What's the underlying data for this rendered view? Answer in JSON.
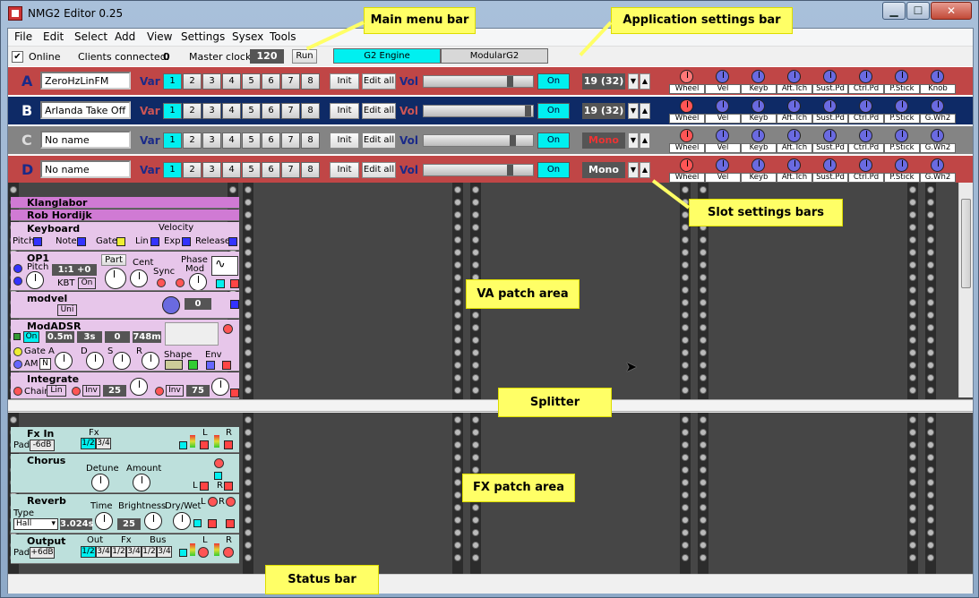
{
  "window": {
    "title": "NMG2 Editor 0.25",
    "min": "▁",
    "max": "☐",
    "close": "✕"
  },
  "menu": [
    "File",
    "Edit",
    "Select",
    "Add",
    "View",
    "Settings",
    "Sysex",
    "Tools"
  ],
  "settings": {
    "online_label": "Online",
    "online_checked": "✔",
    "clients_label": "Clients connected:",
    "clients_value": "0",
    "clock_label": "Master clock",
    "clock_value": "120",
    "run_label": "Run",
    "tab_engine": "G2 Engine",
    "tab_modular": "ModularG2"
  },
  "slot_common": {
    "var_label": "Var",
    "vol_label": "Vol",
    "init_label": "Init",
    "editall_label": "Edit all",
    "on_label": "On",
    "var_numbers": [
      "1",
      "2",
      "3",
      "4",
      "5",
      "6",
      "7",
      "8"
    ],
    "up": "▲",
    "down": "▼"
  },
  "slots": [
    {
      "letter": "A",
      "name": "ZeroHzLinFM",
      "voices": "19 (32)",
      "ctrls": [
        "Wheel",
        "Vel",
        "Keyb",
        "Aft.Tch",
        "Sust.Pd",
        "Ctrl.Pd",
        "P.Stick",
        "Knob"
      ]
    },
    {
      "letter": "B",
      "name": "Arlanda Take Off",
      "voices": "19 (32)",
      "ctrls": [
        "Wheel",
        "Vel",
        "Keyb",
        "Aft.Tch",
        "Sust.Pd",
        "Ctrl.Pd",
        "P.Stick",
        "G.Wh2"
      ]
    },
    {
      "letter": "C",
      "name": "No name",
      "voices": "Mono",
      "ctrls": [
        "Wheel",
        "Vel",
        "Keyb",
        "Aft.Tch",
        "Sust.Pd",
        "Ctrl.Pd",
        "P.Stick",
        "G.Wh2"
      ]
    },
    {
      "letter": "D",
      "name": "No name",
      "voices": "Mono",
      "ctrls": [
        "Wheel",
        "Vel",
        "Keyb",
        "Aft.Tch",
        "Sust.Pd",
        "Ctrl.Pd",
        "P.Stick",
        "G.Wh2"
      ]
    }
  ],
  "va_modules": {
    "klang": "Klanglabor",
    "rob": "Rob Hordijk",
    "keyboard": {
      "title": "Keyboard",
      "velocity": "Velocity",
      "pitch": "Pitch",
      "note": "Note",
      "gate": "Gate",
      "lin": "Lin",
      "exp": "Exp",
      "release": "Release"
    },
    "op1": {
      "title": "OP1",
      "pitch": "Pitch",
      "ratio": "1:1",
      "offset": "+0",
      "part": "Part",
      "cent": "Cent",
      "sync": "Sync",
      "phase": "Phase",
      "mod": "Mod",
      "kbt": "KBT",
      "on": "On"
    },
    "modvel": {
      "title": "modvel",
      "uni": "Uni",
      "value": "0"
    },
    "modadsr": {
      "title": "ModADSR",
      "on": "On",
      "a_val": "0.5m",
      "d_val": "3s",
      "s_val": "0",
      "r_val": "748m",
      "gate": "Gate",
      "am": "AM",
      "n": "N",
      "a": "A",
      "d": "D",
      "s": "S",
      "r": "R",
      "shape": "Shape",
      "env": "Env"
    },
    "integrate": {
      "title": "Integrate",
      "chain": "Chain",
      "lin": "Lin",
      "inv": "Inv",
      "v1": "25",
      "v2": "75"
    }
  },
  "fx_modules": {
    "fxin": {
      "title": "Fx In",
      "fx": "Fx",
      "pad": "Pad",
      "pad_val": "-6dB",
      "b1": "1/2",
      "b2": "3/4",
      "l": "L",
      "r": "R"
    },
    "chorus": {
      "title": "Chorus",
      "detune": "Detune",
      "amount": "Amount",
      "l": "L",
      "r": "R"
    },
    "reverb": {
      "title": "Reverb",
      "type": "Type",
      "hall": "Hall",
      "time": "Time",
      "time_val": "3.024s",
      "brightness": "Brightness",
      "bright_val": "25",
      "drywet": "Dry/Wet",
      "l": "L",
      "r": "R"
    },
    "output": {
      "title": "Output",
      "out": "Out",
      "fx": "Fx",
      "bus": "Bus",
      "pad": "Pad",
      "pad_val": "+6dB",
      "o1": "1/2",
      "o2": "3/4",
      "f1": "1/2",
      "f2": "3/4",
      "b1": "1/2",
      "b2": "3/4",
      "l": "L",
      "r": "R"
    }
  },
  "callouts": {
    "main_menu": "Main menu bar",
    "app_settings": "Application settings bar",
    "slot_settings": "Slot settings bars",
    "va": "VA patch area",
    "splitter": "Splitter",
    "fx": "FX patch area",
    "status": "Status bar"
  },
  "colors": {
    "slot_a": "#c04646",
    "slot_b": "#0e2a66",
    "slot_c": "#848484",
    "slot_d": "#c04646",
    "va_module": "#e7c6ea",
    "fx_module": "#bde0dc",
    "accent_cyan": "#00f0f0"
  }
}
